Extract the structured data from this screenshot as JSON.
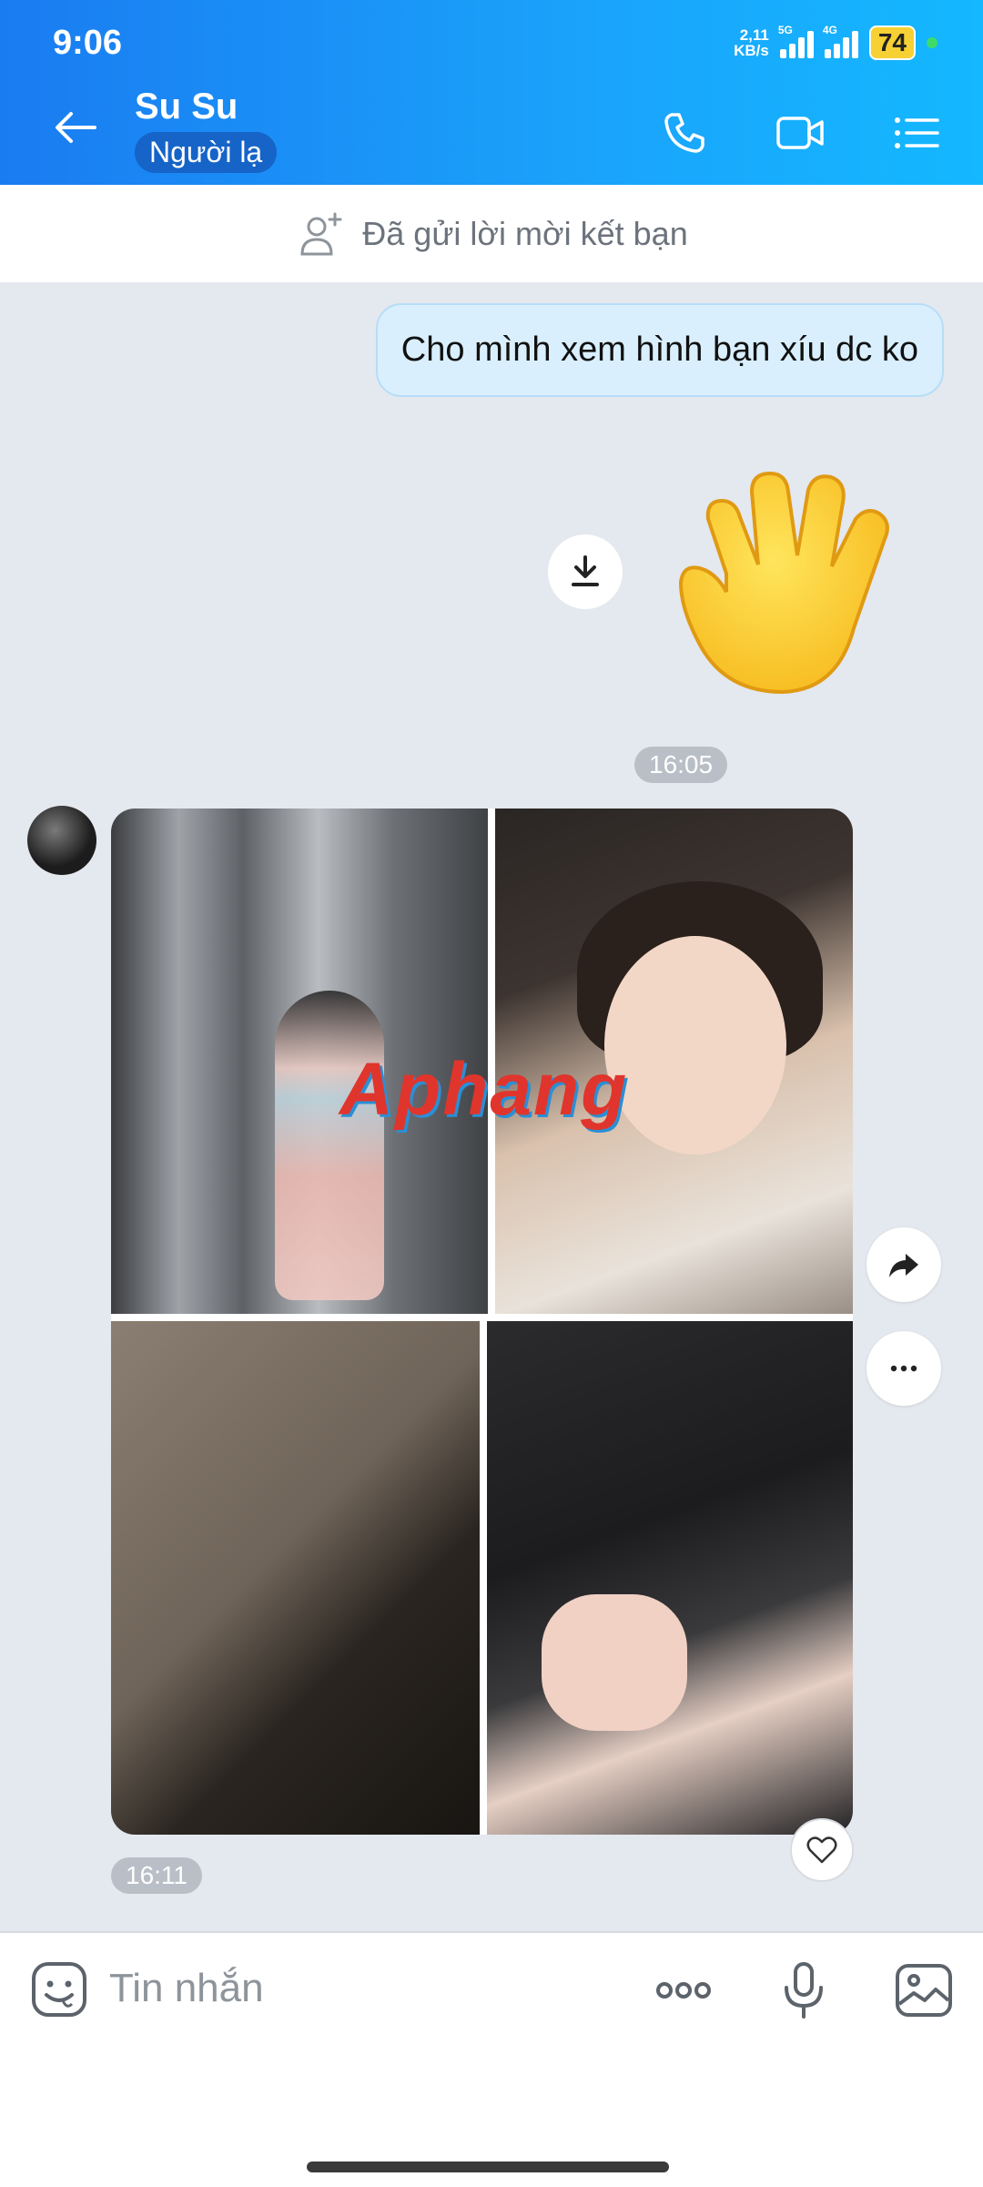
{
  "status": {
    "time": "9:06",
    "speed": "2,11",
    "speed_unit": "KB/s",
    "sig1_tag": "5G",
    "sig2_tag": "4G",
    "battery": "74"
  },
  "header": {
    "name": "Su Su",
    "badge": "Người lạ"
  },
  "friend_bar": {
    "text": "Đã gửi lời mời kết bạn"
  },
  "messages": {
    "outgoing_text": "Cho mình xem hình bạn xíu dc ko",
    "time1": "16:05",
    "time2": "16:11",
    "watermark": "Aphang"
  },
  "composer": {
    "placeholder": "Tin nhắn"
  },
  "colors": {
    "accent": "#1a7cf1",
    "bubble": "#d9effd",
    "battery": "#f7d133"
  },
  "icons": [
    "back-arrow-icon",
    "phone-icon",
    "video-icon",
    "menu-icon",
    "add-friend-icon",
    "download-icon",
    "wave-emoji-icon",
    "share-icon",
    "more-icon",
    "heart-icon",
    "emoji-icon",
    "more-dots-icon",
    "mic-icon",
    "image-icon"
  ]
}
